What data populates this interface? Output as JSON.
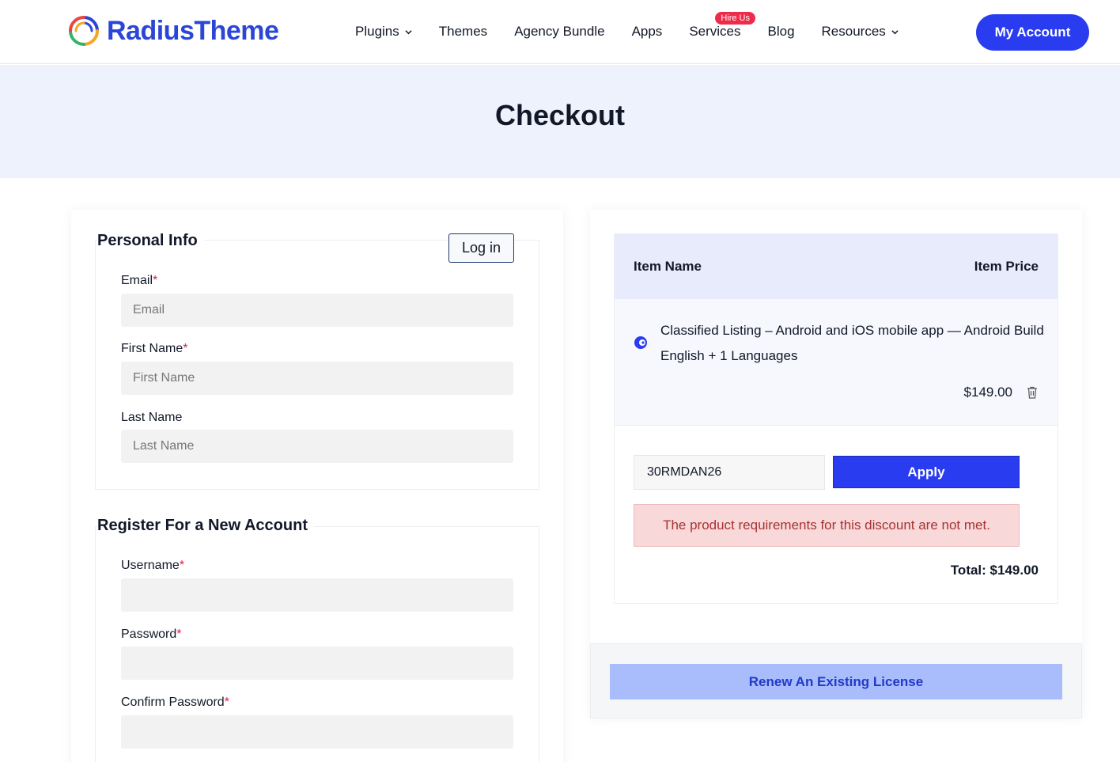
{
  "brand": {
    "name": "RadiusTheme"
  },
  "nav": {
    "items": [
      {
        "label": "Plugins",
        "dropdown": true
      },
      {
        "label": "Themes",
        "dropdown": false
      },
      {
        "label": "Agency Bundle",
        "dropdown": false
      },
      {
        "label": "Apps",
        "dropdown": false
      },
      {
        "label": "Services",
        "dropdown": false,
        "badge": "Hire Us"
      },
      {
        "label": "Blog",
        "dropdown": false
      },
      {
        "label": "Resources",
        "dropdown": true
      }
    ],
    "account_button": "My Account"
  },
  "hero": {
    "title": "Checkout"
  },
  "personal_info": {
    "legend": "Personal Info",
    "login_button": "Log in",
    "email": {
      "label": "Email",
      "placeholder": "Email"
    },
    "first_name": {
      "label": "First Name",
      "placeholder": "First Name"
    },
    "last_name": {
      "label": "Last Name",
      "placeholder": "Last Name"
    }
  },
  "register": {
    "legend": "Register For a New Account",
    "username": {
      "label": "Username"
    },
    "password": {
      "label": "Password"
    },
    "confirm_password": {
      "label": "Confirm Password"
    }
  },
  "required_mark": "*",
  "order": {
    "col_name": "Item Name",
    "col_price": "Item Price",
    "item_name": "Classified Listing – Android and iOS mobile app — Android Build English + 1 Languages",
    "item_price": "$149.00",
    "coupon_value": "30RMDAN26",
    "apply_button": "Apply",
    "error": "The product requirements for this discount are not met.",
    "total": "Total: $149.00",
    "renew_button": "Renew An Existing License"
  },
  "colors": {
    "brand_blue": "#2b46d6",
    "primary_button": "#2a3cf0",
    "badge_red": "#ef2b4b",
    "error_bg": "#f8d8d8",
    "hero_bg": "#eef2fd"
  }
}
